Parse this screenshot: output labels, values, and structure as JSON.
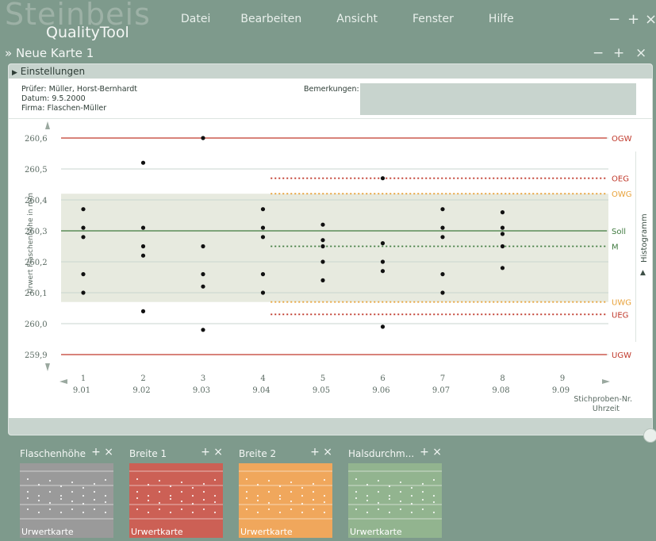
{
  "app": {
    "brand_big": "Steinbeis",
    "brand_small": "QualityTool",
    "menu": [
      "Datei",
      "Bearbeiten",
      "Ansicht",
      "Fenster",
      "Hilfe"
    ],
    "window_controls": [
      "−",
      "+",
      "×"
    ],
    "document_title": "» Neue Karte 1",
    "document_controls": [
      "−",
      "+",
      "×"
    ]
  },
  "settings": {
    "toggle_label": "Einstellungen",
    "info_lines": [
      "Prüfer: Müller, Horst-Bernhardt",
      "Datum: 9.5.2000",
      "Firma: Flaschen-Müller"
    ],
    "remarks_label": "Bemerkungen:",
    "remarks_value": ""
  },
  "side_tab": {
    "label": "Histogramm",
    "arrow": "▲"
  },
  "chart_data": {
    "type": "scatter",
    "ylabel": "Urwert Flaschenhöhe in mm",
    "xlabel": "Stichproben-Nr.",
    "xlabel2": "Uhrzeit",
    "ylim": [
      259.9,
      260.6
    ],
    "yticks": [
      {
        "v": 260.6,
        "label": "260,6"
      },
      {
        "v": 260.5,
        "label": "260,5"
      },
      {
        "v": 260.4,
        "label": "260,4"
      },
      {
        "v": 260.3,
        "label": "260,3"
      },
      {
        "v": 260.2,
        "label": "260,2"
      },
      {
        "v": 260.1,
        "label": "260,1"
      },
      {
        "v": 260.0,
        "label": "260,0"
      },
      {
        "v": 259.9,
        "label": "259,9"
      }
    ],
    "samples": [
      {
        "nr": "1",
        "time": "9.01",
        "values": [
          260.37,
          260.31,
          260.28,
          260.16,
          260.1
        ]
      },
      {
        "nr": "2",
        "time": "9.02",
        "values": [
          260.52,
          260.31,
          260.25,
          260.22,
          260.04
        ]
      },
      {
        "nr": "3",
        "time": "9.03",
        "values": [
          260.6,
          260.25,
          260.16,
          260.12,
          259.98
        ]
      },
      {
        "nr": "4",
        "time": "9.04",
        "values": [
          260.37,
          260.31,
          260.28,
          260.16,
          260.1
        ]
      },
      {
        "nr": "5",
        "time": "9.05",
        "values": [
          260.32,
          260.27,
          260.25,
          260.2,
          260.14
        ]
      },
      {
        "nr": "6",
        "time": "9.06",
        "values": [
          260.47,
          260.26,
          260.2,
          260.17,
          259.99
        ]
      },
      {
        "nr": "7",
        "time": "9.07",
        "values": [
          260.37,
          260.31,
          260.28,
          260.16,
          260.1
        ]
      },
      {
        "nr": "8",
        "time": "9.08",
        "values": [
          260.36,
          260.31,
          260.29,
          260.25,
          260.18
        ]
      },
      {
        "nr": "9",
        "time": "9.09",
        "values": []
      }
    ],
    "limits": [
      {
        "label": "OGW",
        "value": 260.6,
        "style": "solid",
        "color": "#c0392b",
        "from": 1
      },
      {
        "label": "OEG",
        "value": 260.47,
        "style": "dotted",
        "color": "#c0392b",
        "from": 4.5
      },
      {
        "label": "OWG",
        "value": 260.42,
        "style": "dotted",
        "color": "#e8a23a",
        "from": 4.5
      },
      {
        "label": "Soll",
        "value": 260.3,
        "style": "solid",
        "color": "#3f7a3f",
        "from": 1
      },
      {
        "label": "M",
        "value": 260.25,
        "style": "dotted",
        "color": "#3f7a3f",
        "from": 4.5
      },
      {
        "label": "UWG",
        "value": 260.07,
        "style": "dotted",
        "color": "#e8a23a",
        "from": 4.5
      },
      {
        "label": "UEG",
        "value": 260.03,
        "style": "dotted",
        "color": "#c0392b",
        "from": 4.5
      },
      {
        "label": "UGW",
        "value": 259.9,
        "style": "solid",
        "color": "#c0392b",
        "from": 1
      }
    ],
    "tolerance_band": [
      260.07,
      260.42
    ],
    "grid": true
  },
  "thumbnails": [
    {
      "title": "Flaschenhöhe",
      "controls": "+ ×",
      "label": "Urwertkarte",
      "color": "#9a9a9a"
    },
    {
      "title": "Breite 1",
      "controls": "+ ×",
      "label": "Urwertkarte",
      "color": "#cc6055"
    },
    {
      "title": "Breite 2",
      "controls": "+ ×",
      "label": "Urwertkarte",
      "color": "#f0a75c"
    },
    {
      "title": "Halsdurchm...",
      "controls": "+ ×",
      "label": "Urwertkarte",
      "color": "#92b48f"
    }
  ]
}
